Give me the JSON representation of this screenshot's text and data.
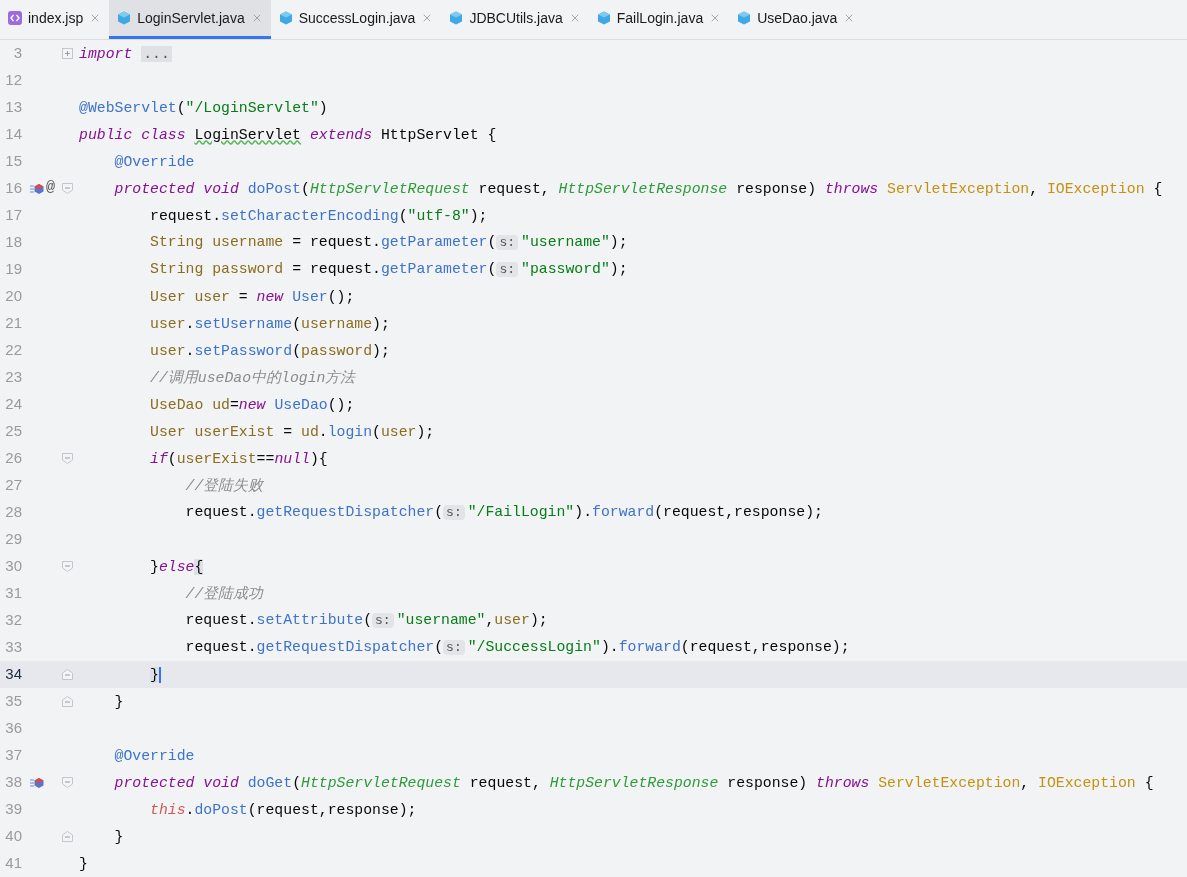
{
  "tabs": [
    {
      "label": "index.jsp",
      "kind": "jsp",
      "selected": false
    },
    {
      "label": "LoginServlet.java",
      "kind": "java",
      "selected": true
    },
    {
      "label": "SuccessLogin.java",
      "kind": "java",
      "selected": false
    },
    {
      "label": "JDBCUtils.java",
      "kind": "java",
      "selected": false
    },
    {
      "label": "FailLogin.java",
      "kind": "java",
      "selected": false
    },
    {
      "label": "UseDao.java",
      "kind": "java",
      "selected": false
    }
  ],
  "lines": [
    {
      "number": "3",
      "current": false,
      "fold": {
        "kind": "collapsed"
      },
      "tokens": [
        {
          "t": "import ",
          "kind": "kw"
        },
        {
          "t": "...",
          "kind": "folded"
        }
      ]
    },
    {
      "number": "12",
      "current": false
    },
    {
      "number": "13",
      "current": false,
      "tokens": [
        {
          "t": "@WebServlet",
          "kind": "ann"
        },
        {
          "t": "(",
          "kind": "p"
        },
        {
          "t": "\"/LoginServlet\"",
          "kind": "str"
        },
        {
          "t": ")",
          "kind": "p"
        }
      ]
    },
    {
      "number": "14",
      "current": false,
      "tokens": [
        {
          "t": "public class ",
          "kind": "kw"
        },
        {
          "t": "LoginServlet",
          "kind": "typo"
        },
        {
          "t": " extends",
          "kind": "kw"
        },
        {
          "t": " HttpServlet {",
          "kind": "p"
        }
      ],
      "children": [
        {
          "number": "15",
          "current": false,
          "tokens": [
            {
              "t": "@Override",
              "kind": "ann"
            }
          ]
        },
        {
          "number": "16",
          "current": false,
          "marker": {
            "kind": "override"
          },
          "gutter_text": "@",
          "fold": {
            "kind": "start"
          },
          "tokens": [
            {
              "t": "protected void ",
              "kind": "kw"
            },
            {
              "t": "doPost",
              "kind": "fn"
            },
            {
              "t": "(",
              "kind": "p"
            },
            {
              "t": "HttpServletRequest",
              "kind": "param"
            },
            {
              "t": " request, ",
              "kind": "p"
            },
            {
              "t": "HttpServletResponse",
              "kind": "param"
            },
            {
              "t": " response) ",
              "kind": "p"
            },
            {
              "t": "throws ",
              "kind": "kw"
            },
            {
              "t": "ServletException",
              "kind": "exc"
            },
            {
              "t": ", ",
              "kind": "p"
            },
            {
              "t": "IOException",
              "kind": "exc"
            },
            {
              "t": " {",
              "kind": "p"
            }
          ],
          "children": [
            {
              "number": "17",
              "current": false,
              "tokens": [
                {
                  "t": "request.",
                  "kind": "p"
                },
                {
                  "t": "setCharacterEncoding",
                  "kind": "fn"
                },
                {
                  "t": "(",
                  "kind": "p"
                },
                {
                  "t": "\"utf-8\"",
                  "kind": "str"
                },
                {
                  "t": ");",
                  "kind": "p"
                }
              ]
            },
            {
              "number": "18",
              "current": false,
              "tokens": [
                {
                  "t": "String ",
                  "kind": "type"
                },
                {
                  "t": "username",
                  "kind": "local"
                },
                {
                  "t": " = request.",
                  "kind": "p"
                },
                {
                  "t": "getParameter",
                  "kind": "fn"
                },
                {
                  "t": "(",
                  "kind": "p"
                },
                {
                  "t": "s:",
                  "kind": "hint"
                },
                {
                  "t": "\"username\"",
                  "kind": "str"
                },
                {
                  "t": ");",
                  "kind": "p"
                }
              ]
            },
            {
              "number": "19",
              "current": false,
              "tokens": [
                {
                  "t": "String ",
                  "kind": "type"
                },
                {
                  "t": "password",
                  "kind": "local"
                },
                {
                  "t": " = request.",
                  "kind": "p"
                },
                {
                  "t": "getParameter",
                  "kind": "fn"
                },
                {
                  "t": "(",
                  "kind": "p"
                },
                {
                  "t": "s:",
                  "kind": "hint"
                },
                {
                  "t": "\"password\"",
                  "kind": "str"
                },
                {
                  "t": ");",
                  "kind": "p"
                }
              ]
            },
            {
              "number": "20",
              "current": false,
              "tokens": [
                {
                  "t": "User ",
                  "kind": "type"
                },
                {
                  "t": "user",
                  "kind": "local"
                },
                {
                  "t": " = ",
                  "kind": "p"
                },
                {
                  "t": "new ",
                  "kind": "kw"
                },
                {
                  "t": "User",
                  "kind": "fn"
                },
                {
                  "t": "();",
                  "kind": "p"
                }
              ]
            },
            {
              "number": "21",
              "current": false,
              "tokens": [
                {
                  "t": "user",
                  "kind": "local"
                },
                {
                  "t": ".",
                  "kind": "p"
                },
                {
                  "t": "setUsername",
                  "kind": "fn"
                },
                {
                  "t": "(",
                  "kind": "p"
                },
                {
                  "t": "username",
                  "kind": "local"
                },
                {
                  "t": ");",
                  "kind": "p"
                }
              ]
            },
            {
              "number": "22",
              "current": false,
              "tokens": [
                {
                  "t": "user",
                  "kind": "local"
                },
                {
                  "t": ".",
                  "kind": "p"
                },
                {
                  "t": "setPassword",
                  "kind": "fn"
                },
                {
                  "t": "(",
                  "kind": "p"
                },
                {
                  "t": "password",
                  "kind": "local"
                },
                {
                  "t": ");",
                  "kind": "p"
                }
              ]
            },
            {
              "number": "23",
              "current": false,
              "tokens": [
                {
                  "t": "//调用useDao中的login方法",
                  "kind": "comment"
                }
              ]
            },
            {
              "number": "24",
              "current": false,
              "tokens": [
                {
                  "t": "UseDao ",
                  "kind": "type"
                },
                {
                  "t": "ud",
                  "kind": "local"
                },
                {
                  "t": "=",
                  "kind": "p"
                },
                {
                  "t": "new ",
                  "kind": "kw"
                },
                {
                  "t": "UseDao",
                  "kind": "fn"
                },
                {
                  "t": "();",
                  "kind": "p"
                }
              ]
            },
            {
              "number": "25",
              "current": false,
              "tokens": [
                {
                  "t": "User ",
                  "kind": "type"
                },
                {
                  "t": "userExist",
                  "kind": "local"
                },
                {
                  "t": " = ",
                  "kind": "p"
                },
                {
                  "t": "ud",
                  "kind": "local"
                },
                {
                  "t": ".",
                  "kind": "p"
                },
                {
                  "t": "login",
                  "kind": "fn"
                },
                {
                  "t": "(",
                  "kind": "p"
                },
                {
                  "t": "user",
                  "kind": "local"
                },
                {
                  "t": ");",
                  "kind": "p"
                }
              ]
            },
            {
              "number": "26",
              "current": false,
              "fold": {
                "kind": "start"
              },
              "tokens": [
                {
                  "t": "if",
                  "kind": "kw"
                },
                {
                  "t": "(",
                  "kind": "p"
                },
                {
                  "t": "userExist",
                  "kind": "local"
                },
                {
                  "t": "==",
                  "kind": "p"
                },
                {
                  "t": "null",
                  "kind": "kw"
                },
                {
                  "t": "){",
                  "kind": "p"
                }
              ],
              "children": [
                {
                  "number": "27",
                  "current": false,
                  "tokens": [
                    {
                      "t": "//登陆失败",
                      "kind": "comment"
                    }
                  ]
                },
                {
                  "number": "28",
                  "current": false,
                  "tokens": [
                    {
                      "t": "request.",
                      "kind": "p"
                    },
                    {
                      "t": "getRequestDispatcher",
                      "kind": "fn"
                    },
                    {
                      "t": "(",
                      "kind": "p"
                    },
                    {
                      "t": "s:",
                      "kind": "hint"
                    },
                    {
                      "t": "\"/FailLogin\"",
                      "kind": "str"
                    },
                    {
                      "t": ").",
                      "kind": "p"
                    },
                    {
                      "t": "forward",
                      "kind": "fn"
                    },
                    {
                      "t": "(request,response);",
                      "kind": "p"
                    }
                  ]
                },
                {
                  "number": "29",
                  "current": false
                }
              ]
            },
            {
              "number": "30",
              "current": false,
              "fold": {
                "kind": "start"
              },
              "tokens": [
                {
                  "t": "}",
                  "kind": "p"
                },
                {
                  "t": "else",
                  "kind": "kw"
                },
                {
                  "t": "{",
                  "kind": "match"
                }
              ],
              "children": [
                {
                  "number": "31",
                  "current": false,
                  "tokens": [
                    {
                      "t": "//登陆成功",
                      "kind": "comment"
                    }
                  ]
                },
                {
                  "number": "32",
                  "current": false,
                  "tokens": [
                    {
                      "t": "request.",
                      "kind": "p"
                    },
                    {
                      "t": "setAttribute",
                      "kind": "fn"
                    },
                    {
                      "t": "(",
                      "kind": "p"
                    },
                    {
                      "t": "s:",
                      "kind": "hint"
                    },
                    {
                      "t": "\"username\"",
                      "kind": "str"
                    },
                    {
                      "t": ",",
                      "kind": "p"
                    },
                    {
                      "t": "user",
                      "kind": "local"
                    },
                    {
                      "t": ");",
                      "kind": "p"
                    }
                  ]
                },
                {
                  "number": "33",
                  "current": false,
                  "tokens": [
                    {
                      "t": "request.",
                      "kind": "p"
                    },
                    {
                      "t": "getRequestDispatcher",
                      "kind": "fn"
                    },
                    {
                      "t": "(",
                      "kind": "p"
                    },
                    {
                      "t": "s:",
                      "kind": "hint"
                    },
                    {
                      "t": "\"/SuccessLogin\"",
                      "kind": "str"
                    },
                    {
                      "t": ").",
                      "kind": "p"
                    },
                    {
                      "t": "forward",
                      "kind": "fn"
                    },
                    {
                      "t": "(request,response);",
                      "kind": "p"
                    }
                  ]
                }
              ]
            },
            {
              "number": "34",
              "current": true,
              "fold": {
                "kind": "end"
              },
              "tokens": [
                {
                  "t": "}",
                  "kind": "match"
                }
              ]
            }
          ]
        },
        {
          "number": "35",
          "current": false,
          "fold": {
            "kind": "end"
          },
          "tokens": [
            {
              "t": "}",
              "kind": "p"
            }
          ]
        },
        {
          "number": "36",
          "current": false
        },
        {
          "number": "37",
          "current": false,
          "tokens": [
            {
              "t": "@Override",
              "kind": "ann"
            }
          ]
        },
        {
          "number": "38",
          "current": false,
          "marker": {
            "kind": "override"
          },
          "fold": {
            "kind": "start"
          },
          "tokens": [
            {
              "t": "protected void ",
              "kind": "kw"
            },
            {
              "t": "doGet",
              "kind": "fn"
            },
            {
              "t": "(",
              "kind": "p"
            },
            {
              "t": "HttpServletRequest",
              "kind": "param"
            },
            {
              "t": " request, ",
              "kind": "p"
            },
            {
              "t": "HttpServletResponse",
              "kind": "param"
            },
            {
              "t": " response) ",
              "kind": "p"
            },
            {
              "t": "throws ",
              "kind": "kw"
            },
            {
              "t": "ServletException",
              "kind": "exc"
            },
            {
              "t": ", ",
              "kind": "p"
            },
            {
              "t": "IOException",
              "kind": "exc"
            },
            {
              "t": " {",
              "kind": "p"
            }
          ],
          "children": [
            {
              "number": "39",
              "current": false,
              "tokens": [
                {
                  "t": "this",
                  "kind": "this"
                },
                {
                  "t": ".",
                  "kind": "p"
                },
                {
                  "t": "doPost",
                  "kind": "fn"
                },
                {
                  "t": "(request,response);",
                  "kind": "p"
                }
              ]
            }
          ]
        },
        {
          "number": "40",
          "current": false,
          "fold": {
            "kind": "end"
          },
          "tokens": [
            {
              "t": "}",
              "kind": "p"
            }
          ]
        }
      ]
    },
    {
      "number": "41",
      "current": false,
      "tokens": [
        {
          "t": "}",
          "kind": "p"
        }
      ]
    }
  ]
}
